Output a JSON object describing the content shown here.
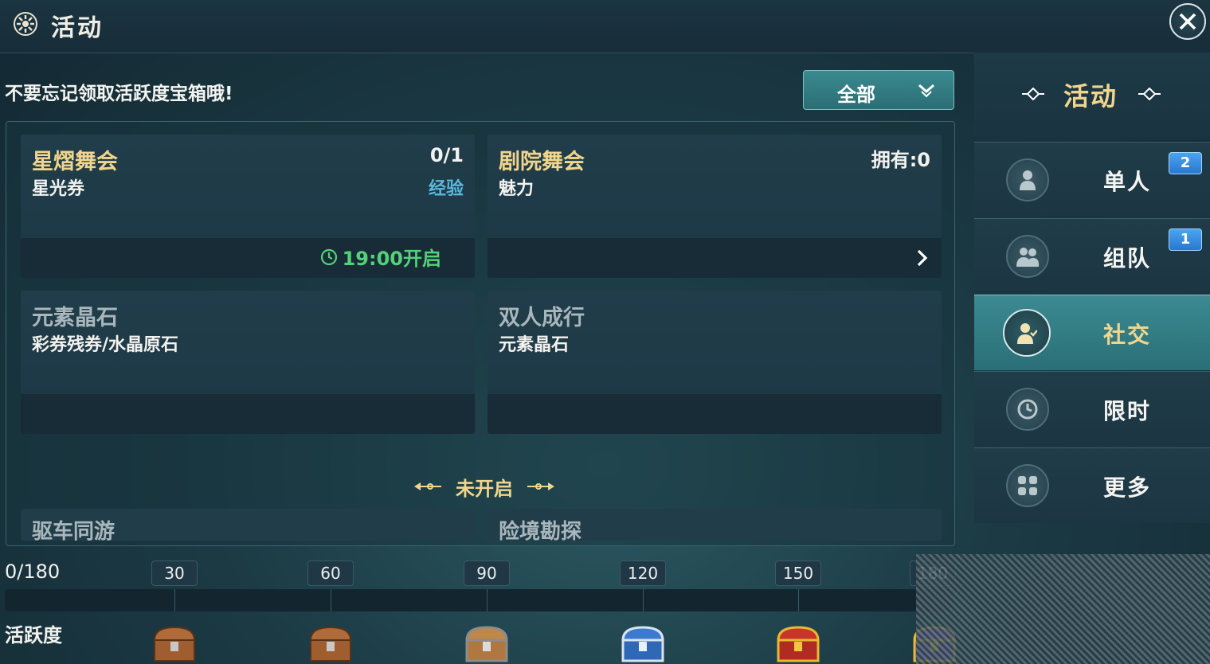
{
  "header": {
    "title": "活动",
    "close_icon": "close-icon"
  },
  "hint": "不要忘记领取活跃度宝箱哦!",
  "filter": {
    "selected": "全部"
  },
  "cards": [
    {
      "name": "星熠舞会",
      "sub": "星光券",
      "count": "0/1",
      "reward": "经验",
      "time": "19:00开启"
    },
    {
      "name": "剧院舞会",
      "sub": "魅力",
      "count": "拥有:0"
    },
    {
      "name": "元素晶石",
      "sub": "彩券残券/水晶原石"
    },
    {
      "name": "双人成行",
      "sub": "元素晶石"
    }
  ],
  "divider": "未开启",
  "peek": [
    "驱车同游",
    "险境勘探"
  ],
  "sidebar": {
    "header": "活动",
    "items": [
      {
        "label": "单人",
        "badge": "2",
        "icon": "single-person-icon"
      },
      {
        "label": "组队",
        "badge": "1",
        "icon": "team-icon"
      },
      {
        "label": "社交",
        "icon": "social-icon",
        "active": true
      },
      {
        "label": "限时",
        "icon": "clock-icon"
      },
      {
        "label": "更多",
        "icon": "grid-icon"
      }
    ]
  },
  "activity": {
    "progress_text": "0/180",
    "label": "活跃度",
    "value": 0,
    "max": 180,
    "milestones": [
      "30",
      "60",
      "90",
      "120",
      "150",
      "180"
    ]
  }
}
